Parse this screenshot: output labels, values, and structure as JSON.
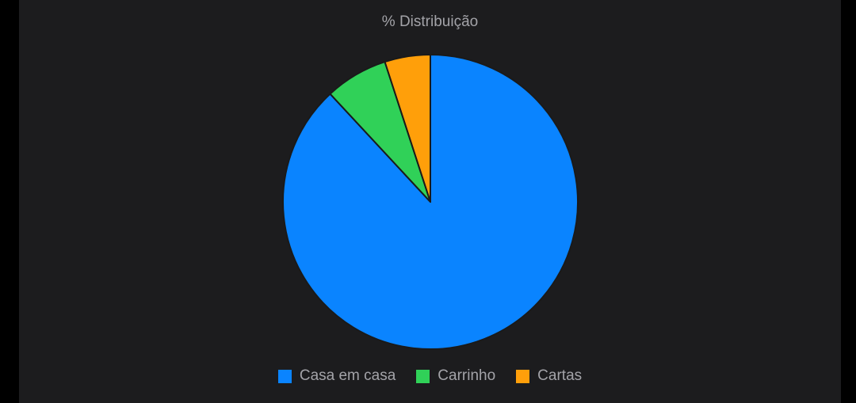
{
  "chart_data": {
    "type": "pie",
    "title": "% Distribuição",
    "categories": [
      "Casa em casa",
      "Carrinho",
      "Cartas"
    ],
    "values": [
      88.1,
      6.9,
      5.0
    ],
    "colors": [
      "#0a84ff",
      "#30d158",
      "#ff9f0a"
    ],
    "legend_position": "bottom"
  },
  "colors": {
    "background": "#1c1c1e",
    "text": "#a3a3a8",
    "slice_border": "#1c1c1e"
  }
}
